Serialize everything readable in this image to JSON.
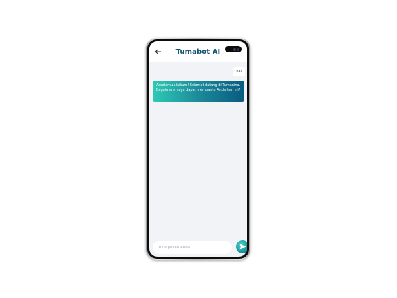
{
  "app": {
    "title": "Tumabot AI"
  },
  "icons": {
    "back": "arrow-left-icon",
    "send": "send-icon"
  },
  "colors": {
    "title": "#13536e",
    "bubble_gradient_start": "#2ec9b5",
    "bubble_gradient_end": "#085b80",
    "background": "#f2f3f7"
  },
  "messages": [
    {
      "sender": "user",
      "text": "hai"
    },
    {
      "sender": "bot",
      "text": "Assalamu'alaikum! Selamat datang di Tumanina. Bagaimana saya dapat membantu Anda hari ini?"
    }
  ],
  "input": {
    "placeholder": "Tulis pesan Anda..."
  }
}
